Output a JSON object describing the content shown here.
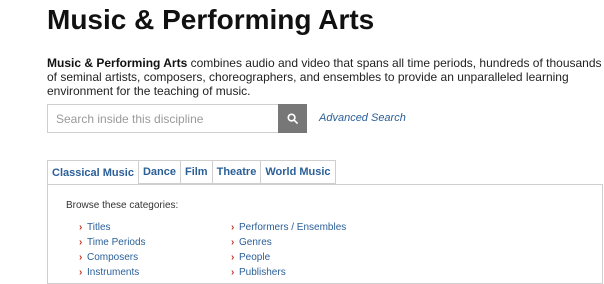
{
  "header": {
    "title": "Music & Performing Arts"
  },
  "intro": {
    "bold_term": "Music & Performing Arts",
    "text": " combines audio and video that spans all time periods, hundreds of thousands of seminal artists, composers, choreographers, and ensembles to provide an unparalleled learning environment for the teaching of music."
  },
  "search": {
    "placeholder": "Search inside this discipline",
    "button_icon": "search-icon",
    "advanced_label": "Advanced Search"
  },
  "tabs": [
    {
      "label": "Classical Music",
      "active": true
    },
    {
      "label": "Dance",
      "active": false
    },
    {
      "label": "Film",
      "active": false
    },
    {
      "label": "Theatre",
      "active": false
    },
    {
      "label": "World Music",
      "active": false
    }
  ],
  "panel": {
    "browse_label": "Browse these categories:",
    "arrow_glyph": "›",
    "column1": [
      "Titles",
      "Time Periods",
      "Composers",
      "Instruments"
    ],
    "column2": [
      "Performers / Ensembles",
      "Genres",
      "People",
      "Publishers"
    ]
  },
  "colors": {
    "link": "#2a5f98",
    "arrow": "#c0392b",
    "search_button": "#777777"
  }
}
